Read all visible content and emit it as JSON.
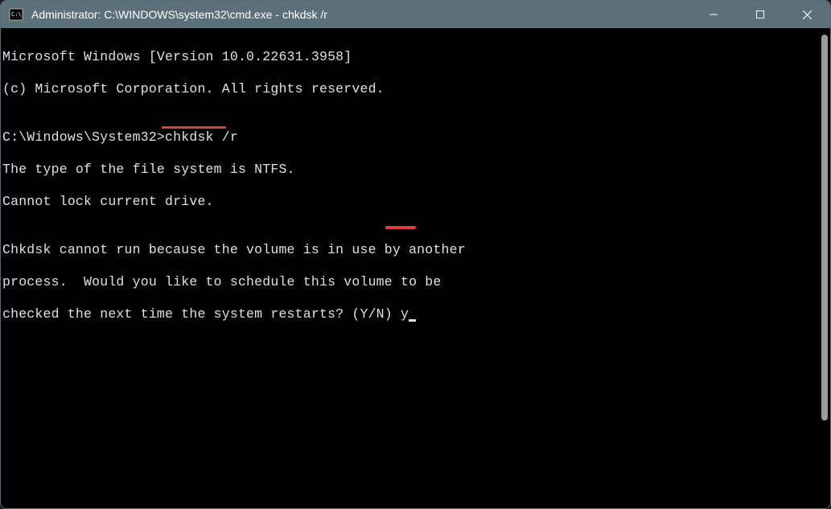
{
  "titlebar": {
    "title": "Administrator: C:\\WINDOWS\\system32\\cmd.exe - chkdsk  /r"
  },
  "terminal": {
    "line1": "Microsoft Windows [Version 10.0.22631.3958]",
    "line2": "(c) Microsoft Corporation. All rights reserved.",
    "blank1": "",
    "prompt_prefix": "C:\\Windows\\System32>",
    "prompt_cmd": "chkdsk /r",
    "line4": "The type of the file system is NTFS.",
    "line5": "Cannot lock current drive.",
    "blank2": "",
    "line6": "Chkdsk cannot run because the volume is in use by another",
    "line7": "process.  Would you like to schedule this volume to be",
    "line8_prefix": "checked the next time the system restarts? (Y/N) ",
    "line8_input": "y"
  }
}
